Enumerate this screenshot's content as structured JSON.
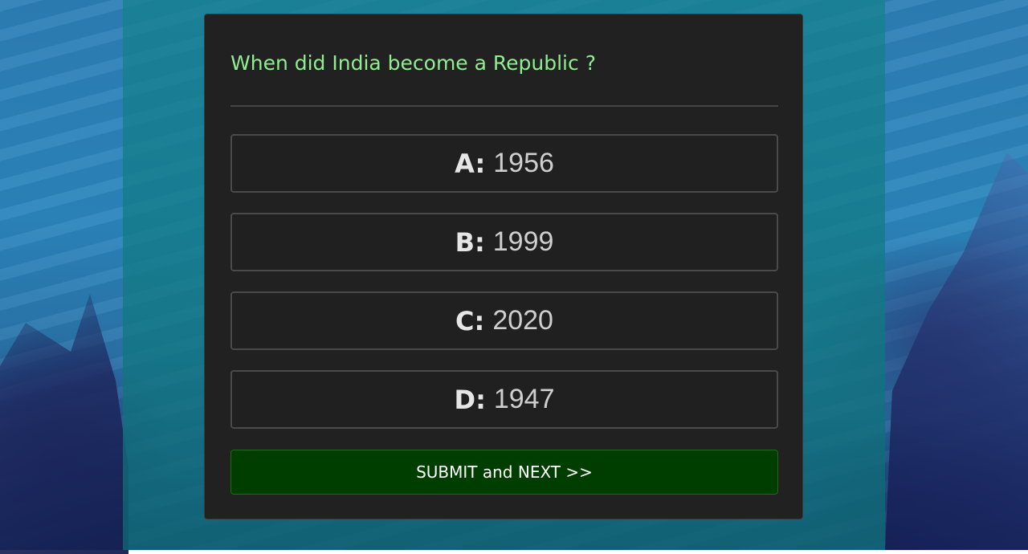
{
  "quiz": {
    "question": "When did India become a Republic ?",
    "options": [
      {
        "letter": "A:",
        "answer": "1956"
      },
      {
        "letter": "B:",
        "answer": "1999"
      },
      {
        "letter": "C:",
        "answer": "2020"
      },
      {
        "letter": "D:",
        "answer": "1947"
      }
    ],
    "submit_label": "SUBMIT and NEXT >>"
  },
  "colors": {
    "question_text": "#90ee90",
    "card_background": "#212121",
    "submit_background": "#003e00",
    "option_border": "#4a4a4a"
  }
}
